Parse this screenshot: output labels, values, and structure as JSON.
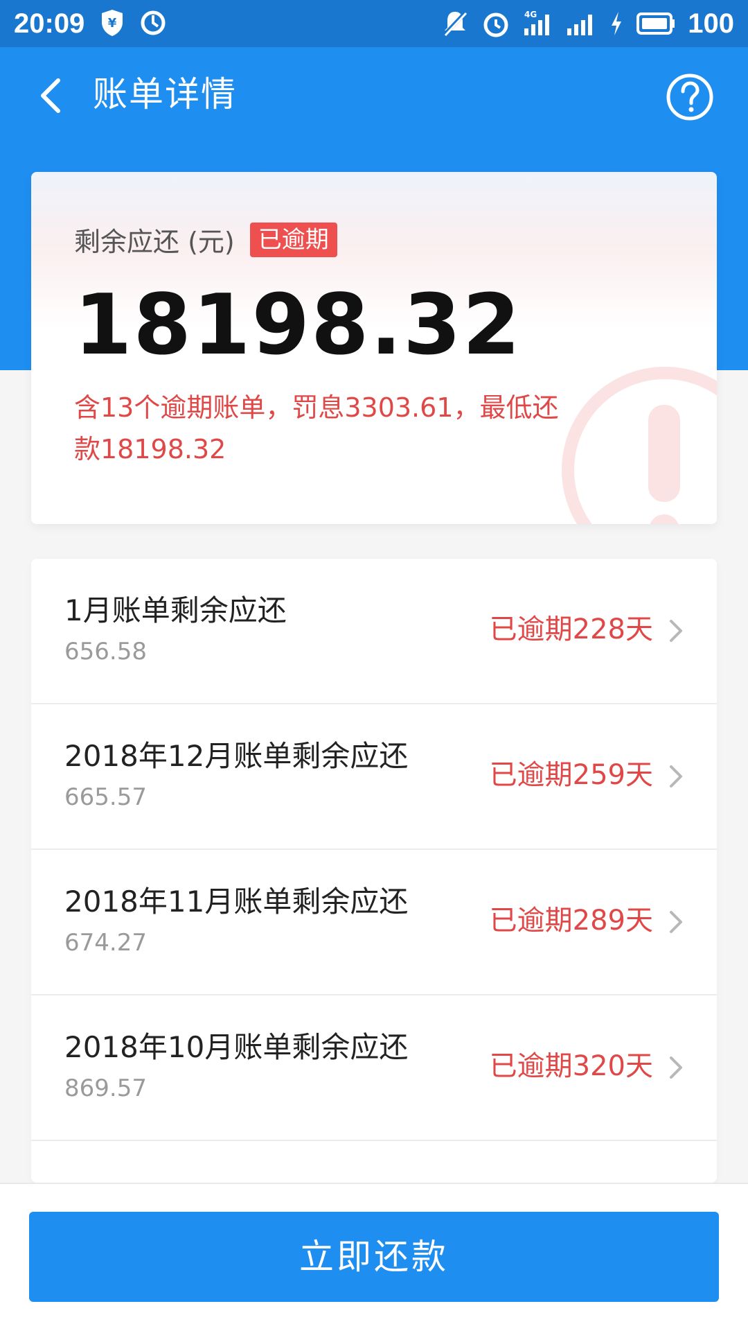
{
  "status_bar": {
    "time": "20:09",
    "battery": "100",
    "icons": [
      "alipay-shield-icon",
      "sync-icon",
      "mute-icon",
      "alarm-icon",
      "signal-4g-icon",
      "signal-icon",
      "charging-icon",
      "battery-icon"
    ]
  },
  "header": {
    "title": "账单详情",
    "back_icon": "chevron-left-icon",
    "help_icon": "question-circle-icon"
  },
  "summary": {
    "label": "剩余应还 (元)",
    "badge": "已逾期",
    "amount": "18198.32",
    "note": "含13个逾期账单，罚息3303.61，最低还款18198.32"
  },
  "bills": [
    {
      "title": "1月账单剩余应还",
      "amount": "656.58",
      "status": "已逾期228天"
    },
    {
      "title": "2018年12月账单剩余应还",
      "amount": "665.57",
      "status": "已逾期259天"
    },
    {
      "title": "2018年11月账单剩余应还",
      "amount": "674.27",
      "status": "已逾期289天"
    },
    {
      "title": "2018年10月账单剩余应还",
      "amount": "869.57",
      "status": "已逾期320天"
    }
  ],
  "bottom": {
    "pay_button": "立即还款"
  },
  "colors": {
    "primary": "#1f8ef1",
    "status_bar": "#1977cf",
    "overdue_red": "#e04848",
    "badge_red": "#ee5050"
  }
}
